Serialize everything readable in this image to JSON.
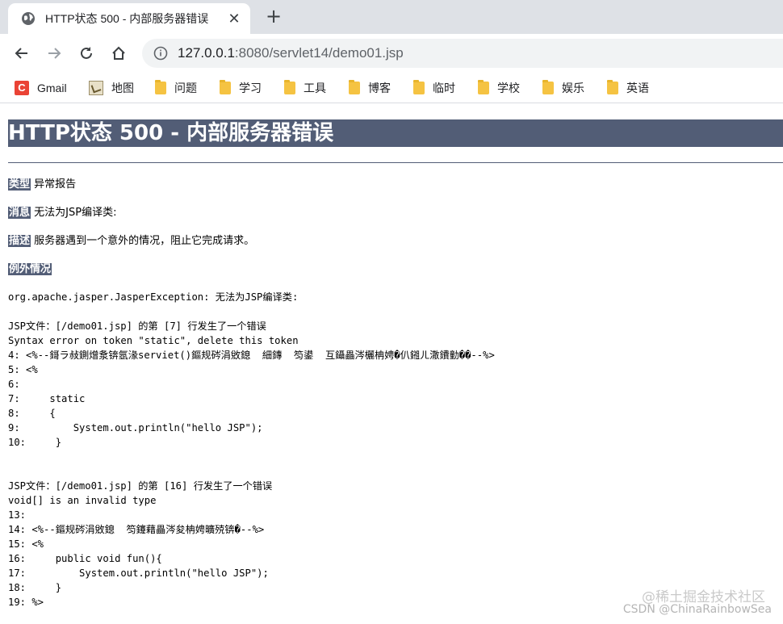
{
  "browser": {
    "tab_title": "HTTP状态 500 - 内部服务器错误",
    "url_host": "127.0.0.1",
    "url_rest": ":8080/servlet14/demo01.jsp",
    "bookmarks": [
      {
        "label": "Gmail"
      },
      {
        "label": "地图"
      },
      {
        "label": "问题"
      },
      {
        "label": "学习"
      },
      {
        "label": "工具"
      },
      {
        "label": "博客"
      },
      {
        "label": "临时"
      },
      {
        "label": "学校"
      },
      {
        "label": "娱乐"
      },
      {
        "label": "英语"
      }
    ]
  },
  "page": {
    "title": "HTTP状态 500 - 内部服务器错误",
    "type_label": "类型",
    "type_value": "异常报告",
    "message_label": "消息",
    "message_value": "无法为JSP编译类:",
    "desc_label": "描述",
    "desc_value": "服务器遇到一个意外的情况，阻止它完成请求。",
    "exception_label": "例外情况",
    "exception_line": "org.apache.jasper.JasperException: 无法为JSP编译类:",
    "trace1": "JSP文件：[/demo01.jsp] 的第 [7] 行发生了一个错误\nSyntax error on token \"static\", delete this token\n4: <%--鎶ラ敊鍘熷洜锛氬湪serviet()鏂规硶涓敓鎴  細鏄  笉鍙  互鑷畾涔欐柟娉�仈鎺ㄦ潵鐨勭��--%>\n5: <%\n6:\n7:     static\n8:     {\n9:         System.out.println(\"hello JSP\");\n10:     }",
    "trace2": "JSP文件：[/demo01.jsp] 的第 [16] 行发生了一个错误\nvoid[] is an invalid type\n13:\n14: <%--鏂规硶涓敓鎴  笉鑳藉畾涔夋柟娉曠殑锛�--%>\n15: <%\n16:     public void fun(){\n17:         System.out.println(\"hello JSP\");\n18:     }\n19: %>"
  },
  "watermark": {
    "line1": "@稀土掘金技术社区",
    "line2": "CSDN @ChinaRainbowSea"
  },
  "colors": {
    "header_bg": "#525d76",
    "tabstrip_bg": "#dee1e6",
    "omnibox_bg": "#f1f3f4"
  }
}
